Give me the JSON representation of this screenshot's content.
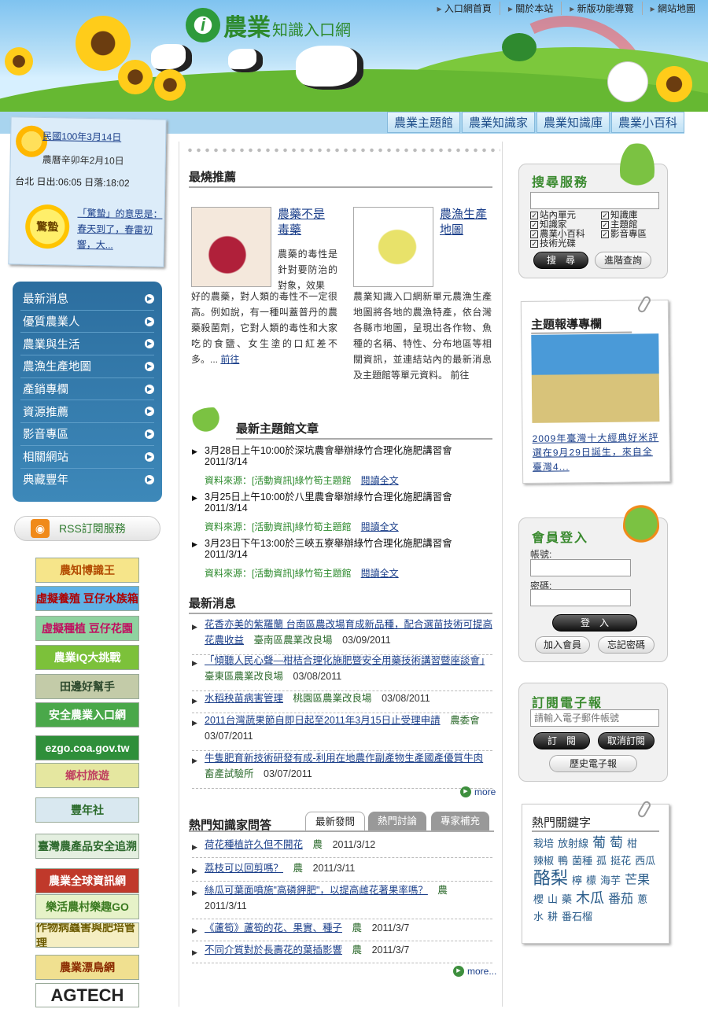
{
  "site": {
    "logo_main": "農業",
    "logo_sub": "知識入口網"
  },
  "toplinks": [
    "入口網首頁",
    "關於本站",
    "新版功能導覽",
    "網站地圖"
  ],
  "navtabs": [
    "農業主題館",
    "農業知識家",
    "農業知識庫",
    "農業小百科"
  ],
  "datecard": {
    "roc_date": "民國100年3月14日",
    "lunar_date": "農曆辛卯年2月10日",
    "sun_times": "台北 日出:06:05 日落:18:02",
    "solar_term": "驚蟄",
    "term_text": "「驚蟄」的意思是：春天到了，春雷初響，大..."
  },
  "leftmenu": [
    "最新消息",
    "優質農業人",
    "農業與生活",
    "農漁生產地圖",
    "產銷專欄",
    "資源推薦",
    "影音專區",
    "相關網站",
    "典藏豐年"
  ],
  "rss_label": "RSS訂閱服務",
  "banners": [
    {
      "label": "農知博識王",
      "bg": "#f6e58a",
      "fg": "#b24a00"
    },
    {
      "label": "虛擬養殖 豆仔水族箱",
      "bg": "#5fb2e6",
      "fg": "#b00000"
    },
    {
      "label": "虛擬種植 豆仔花園",
      "bg": "#8fd2a0",
      "fg": "#c01060"
    },
    {
      "label": "農業IQ大挑戰",
      "bg": "#7cc13a",
      "fg": "#ffffff"
    },
    {
      "label": "田邊好幫手",
      "bg": "#c3cba8",
      "fg": "#2e4a2e"
    },
    {
      "label": "安全農業入口網",
      "bg": "#4aa84a",
      "fg": "#ffffff"
    },
    {
      "label": "ezgo.coa.gov.tw",
      "bg": "#2f8f3a",
      "fg": "#ffffff"
    },
    {
      "label": "鄉村旅遊",
      "bg": "#e5e7a0",
      "fg": "#c04060"
    },
    {
      "label": "豐年社",
      "bg": "#d9e8f0",
      "fg": "#2a6a2a"
    },
    {
      "label": "臺灣農產品安全追溯",
      "bg": "#e4efe0",
      "fg": "#2e6a2e"
    },
    {
      "label": "農業全球資訊網",
      "bg": "#c0392b",
      "fg": "#ffffff"
    },
    {
      "label": "樂活農村樂趣GO",
      "bg": "#e6f2c8",
      "fg": "#3a7a20"
    },
    {
      "label": "作物病蟲害與肥培管理",
      "bg": "#f5eec2",
      "fg": "#6b5a00"
    },
    {
      "label": "農業漂鳥網",
      "bg": "#f0e090",
      "fg": "#8a2a00"
    },
    {
      "label": "AGTECH",
      "bg": "#ffffff",
      "fg": "#222222"
    }
  ],
  "hot": {
    "heading": "最燒推薦",
    "items": [
      {
        "title": "農藥不是毒藥",
        "text": "農藥的毒性是針對要防治的對象，效果好的農藥，對人類的毒性不一定很高。例如說，有一種叫蓋普丹的農藥殺菌劑，它對人類的毒性和大家吃的食鹽、女生塗的口紅差不多。...",
        "more": "前往"
      },
      {
        "title": "農漁生產地圖",
        "text": "農業知識入口網新單元農漁生產地圖將各地的農漁特產，依台灣各縣市地圖，呈現出各作物、魚種的名稱、特性、分布地區等相關資訊，並連結站內的最新消息及主題館等單元資料。",
        "more": "前往"
      }
    ]
  },
  "theme": {
    "heading": "最新主題館文章",
    "items": [
      {
        "title": "3月28日上午10:00於深坑農會舉辦綠竹合理化施肥講習會　2011/3/14",
        "source": "資料來源：[活動資訊]綠竹筍主題館",
        "read": "閱讀全文"
      },
      {
        "title": "3月25日上午10:00於八里農會舉辦綠竹合理化施肥講習會　2011/3/14",
        "source": "資料來源：[活動資訊]綠竹筍主題館",
        "read": "閱讀全文"
      },
      {
        "title": "3月23日下午13:00於三峽五寮舉辦綠竹合理化施肥講習會　2011/3/14",
        "source": "資料來源：[活動資訊]綠竹筍主題館",
        "read": "閱讀全文"
      }
    ]
  },
  "news": {
    "heading": "最新消息",
    "items": [
      {
        "title": "花香亦美的紫羅蘭 台南區農改場育成新品種，配合選苗技術可提高花農收益",
        "source": "臺南區農業改良場",
        "date": "03/09/2011"
      },
      {
        "title": "「傾聽人民心聲—柑桔合理化施肥暨安全用藥技術講習暨座談會」",
        "source": "臺東區農業改良場",
        "date": "03/08/2011"
      },
      {
        "title": "水稻秧苗病害管理",
        "source": "桃園區農業改良場",
        "date": "03/08/2011"
      },
      {
        "title": "2011台灣蔬果節自即日起至2011年3月15日止受理申請",
        "source": "農委會",
        "date": "03/07/2011"
      },
      {
        "title": "牛隻肥育新技術研發有成-利用在地農作副產物生產國產優質牛肉",
        "source": "畜產試驗所",
        "date": "03/07/2011"
      }
    ],
    "more": "more"
  },
  "qa": {
    "heading": "熱門知識家問答",
    "tabs": [
      "最新發問",
      "熱門討論",
      "專家補充"
    ],
    "items": [
      {
        "title": "荷花種植許久但不開花",
        "cat": "農",
        "date": "2011/3/12"
      },
      {
        "title": "荔枝可以回剪嗎？",
        "cat": "農",
        "date": "2011/3/11"
      },
      {
        "title": "絲瓜可葉面噴施\"高磷鉀肥\"，以提高雌花著果率嗎？",
        "cat": "農",
        "date": "2011/3/11"
      },
      {
        "title": "《蘆筍》蘆筍的花、果實、種子",
        "cat": "農",
        "date": "2011/3/7"
      },
      {
        "title": "不同介質對於長壽花的葉插影響",
        "cat": "農",
        "date": "2011/3/7"
      }
    ],
    "more": "more..."
  },
  "search": {
    "heading": "搜尋服務",
    "options": [
      "站內單元",
      "知識庫",
      "知識家",
      "主題館",
      "農業小百科",
      "影音專區",
      "技術光碟"
    ],
    "search_btn": "搜　尋",
    "advanced_btn": "進階查詢"
  },
  "feature": {
    "heading": "主題報導專欄",
    "caption": "2009年臺灣十大經典好米評選在9月29日誕生，來自全臺灣4..."
  },
  "login": {
    "heading": "會員登入",
    "account_label": "帳號:",
    "password_label": "密碼:",
    "login_btn": "登　入",
    "join_btn": "加入會員",
    "forgot_btn": "忘記密碼"
  },
  "newsletter": {
    "heading": "訂閱電子報",
    "placeholder": "請輸入電子郵件帳號",
    "subscribe_btn": "訂　閱",
    "cancel_btn": "取消訂閱",
    "history_btn": "歷史電子報"
  },
  "keywords": {
    "heading": "熱門關鍵字",
    "items": [
      {
        "t": "栽培",
        "s": 13
      },
      {
        "t": "放射線",
        "s": 13
      },
      {
        "t": "葡",
        "s": 17
      },
      {
        "t": "萄",
        "s": 17
      },
      {
        "t": "柑",
        "s": 13
      },
      {
        "t": "辣椒",
        "s": 13
      },
      {
        "t": "鴨",
        "s": 13
      },
      {
        "t": "菌種",
        "s": 13
      },
      {
        "t": "孤",
        "s": 13
      },
      {
        "t": "挺花",
        "s": 13
      },
      {
        "t": "西瓜",
        "s": 13
      },
      {
        "t": "酪梨",
        "s": 22
      },
      {
        "t": "檸",
        "s": 13
      },
      {
        "t": "檬",
        "s": 13
      },
      {
        "t": "海芋",
        "s": 13
      },
      {
        "t": "芒果",
        "s": 16
      },
      {
        "t": "櫻",
        "s": 13
      },
      {
        "t": "山",
        "s": 13
      },
      {
        "t": "藥",
        "s": 13
      },
      {
        "t": "木瓜",
        "s": 18
      },
      {
        "t": "番茄",
        "s": 16
      },
      {
        "t": "蔥",
        "s": 13
      },
      {
        "t": "水",
        "s": 13
      },
      {
        "t": "耕",
        "s": 13
      },
      {
        "t": "番石榴",
        "s": 13
      }
    ]
  }
}
